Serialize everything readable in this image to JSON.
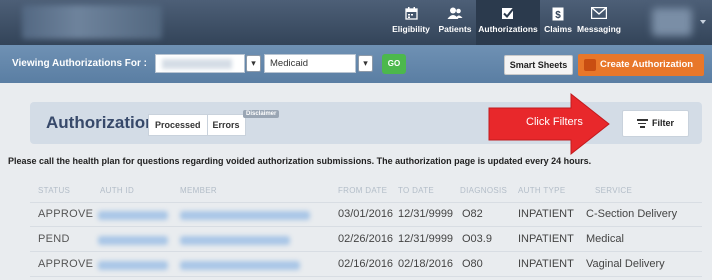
{
  "nav": {
    "items": [
      {
        "label": "Eligibility",
        "icon": "calendar-icon"
      },
      {
        "label": "Patients",
        "icon": "patients-icon"
      },
      {
        "label": "Authorizations",
        "icon": "checkbox-icon",
        "active": true
      },
      {
        "label": "Claims",
        "icon": "dollar-document-icon"
      },
      {
        "label": "Messaging",
        "icon": "envelope-icon"
      }
    ]
  },
  "toolbar": {
    "viewing_label": "Viewing Authorizations For :",
    "plan_value": "Medicaid",
    "go_label": "GO",
    "smart_sheets_label": "Smart Sheets",
    "create_label": "Create Authorization"
  },
  "panel": {
    "title": "Authorizations",
    "tabs": [
      "Processed",
      "Errors"
    ],
    "disclaimer": "Disclaimer",
    "filter_label": "Filter"
  },
  "annotation": {
    "text": "Click Filters",
    "color": "#e8282b"
  },
  "notice": "Please call the health plan for questions regarding voided authorization submissions. The authorization page is updated every 24 hours.",
  "table": {
    "headers": [
      "STATUS",
      "AUTH ID",
      "MEMBER",
      "FROM DATE",
      "TO DATE",
      "DIAGNOSIS",
      "AUTH TYPE",
      "SERVICE"
    ],
    "rows": [
      {
        "status": "APPROVE",
        "from": "03/01/2016",
        "to": "12/31/9999",
        "diagnosis": "O82",
        "auth_type": "INPATIENT",
        "service": "C-Section Delivery"
      },
      {
        "status": "PEND",
        "from": "02/26/2016",
        "to": "12/31/9999",
        "diagnosis": "O03.9",
        "auth_type": "INPATIENT",
        "service": "Medical"
      },
      {
        "status": "APPROVE",
        "from": "02/16/2016",
        "to": "02/18/2016",
        "diagnosis": "O80",
        "auth_type": "INPATIENT",
        "service": "Vaginal Delivery"
      }
    ]
  },
  "colors": {
    "topbar": "#3f5169",
    "subbar": "#6688ac",
    "create_button": "#e8772a",
    "go_button": "#4cb84c",
    "title_text": "#37496a"
  }
}
